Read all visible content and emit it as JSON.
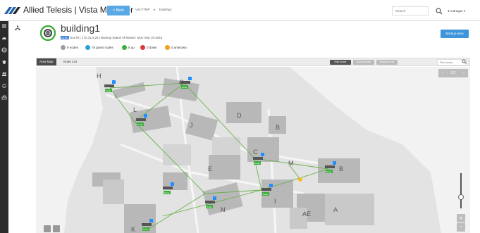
{
  "app": {
    "brand": "Allied Telesis | Vista Manager"
  },
  "topbar": {
    "back_label": "< Back",
    "breadcrumb": [
      "Vst-VTMP",
      "building1"
    ],
    "search_placeholder": "Search",
    "user_label": "manager"
  },
  "header": {
    "title": "building1",
    "subtitle_tag": "x230",
    "subtitle": "box78 | 172.31.0.26 | Backup Status of Master: Mon Sep 19 2016",
    "stats": [
      {
        "label": "9 nodes",
        "color": "#9e9e9e"
      },
      {
        "label": "78 guest nodes",
        "color": "#29a3d6"
      },
      {
        "label": "8 up",
        "color": "#3cae3c"
      },
      {
        "label": "0 down",
        "color": "#d83b3b"
      },
      {
        "label": "0 unknown",
        "color": "#f0a020"
      }
    ],
    "backup_label": "Backup area"
  },
  "tabs": [
    {
      "label": "Area Map",
      "active": true
    },
    {
      "label": "Node List",
      "active": false
    }
  ],
  "toolbar": {
    "edit_label": "Edit mode",
    "add_label": "Add to area",
    "backup_label": "Backup now",
    "find_placeholder": "Find node..."
  },
  "map": {
    "building_labels": [
      "H",
      "G",
      "L",
      "J",
      "D",
      "B",
      "C",
      "M",
      "B",
      "E",
      "N",
      "I",
      "AE",
      "A",
      "K"
    ],
    "node_labels": [
      "Node",
      "Node",
      "Node",
      "Node",
      "Node",
      "Node",
      "Node",
      "Node",
      "Node"
    ],
    "link_color": "#6ab04c",
    "node_tag_color": "#1f8fff",
    "pager_page": "1/2"
  }
}
